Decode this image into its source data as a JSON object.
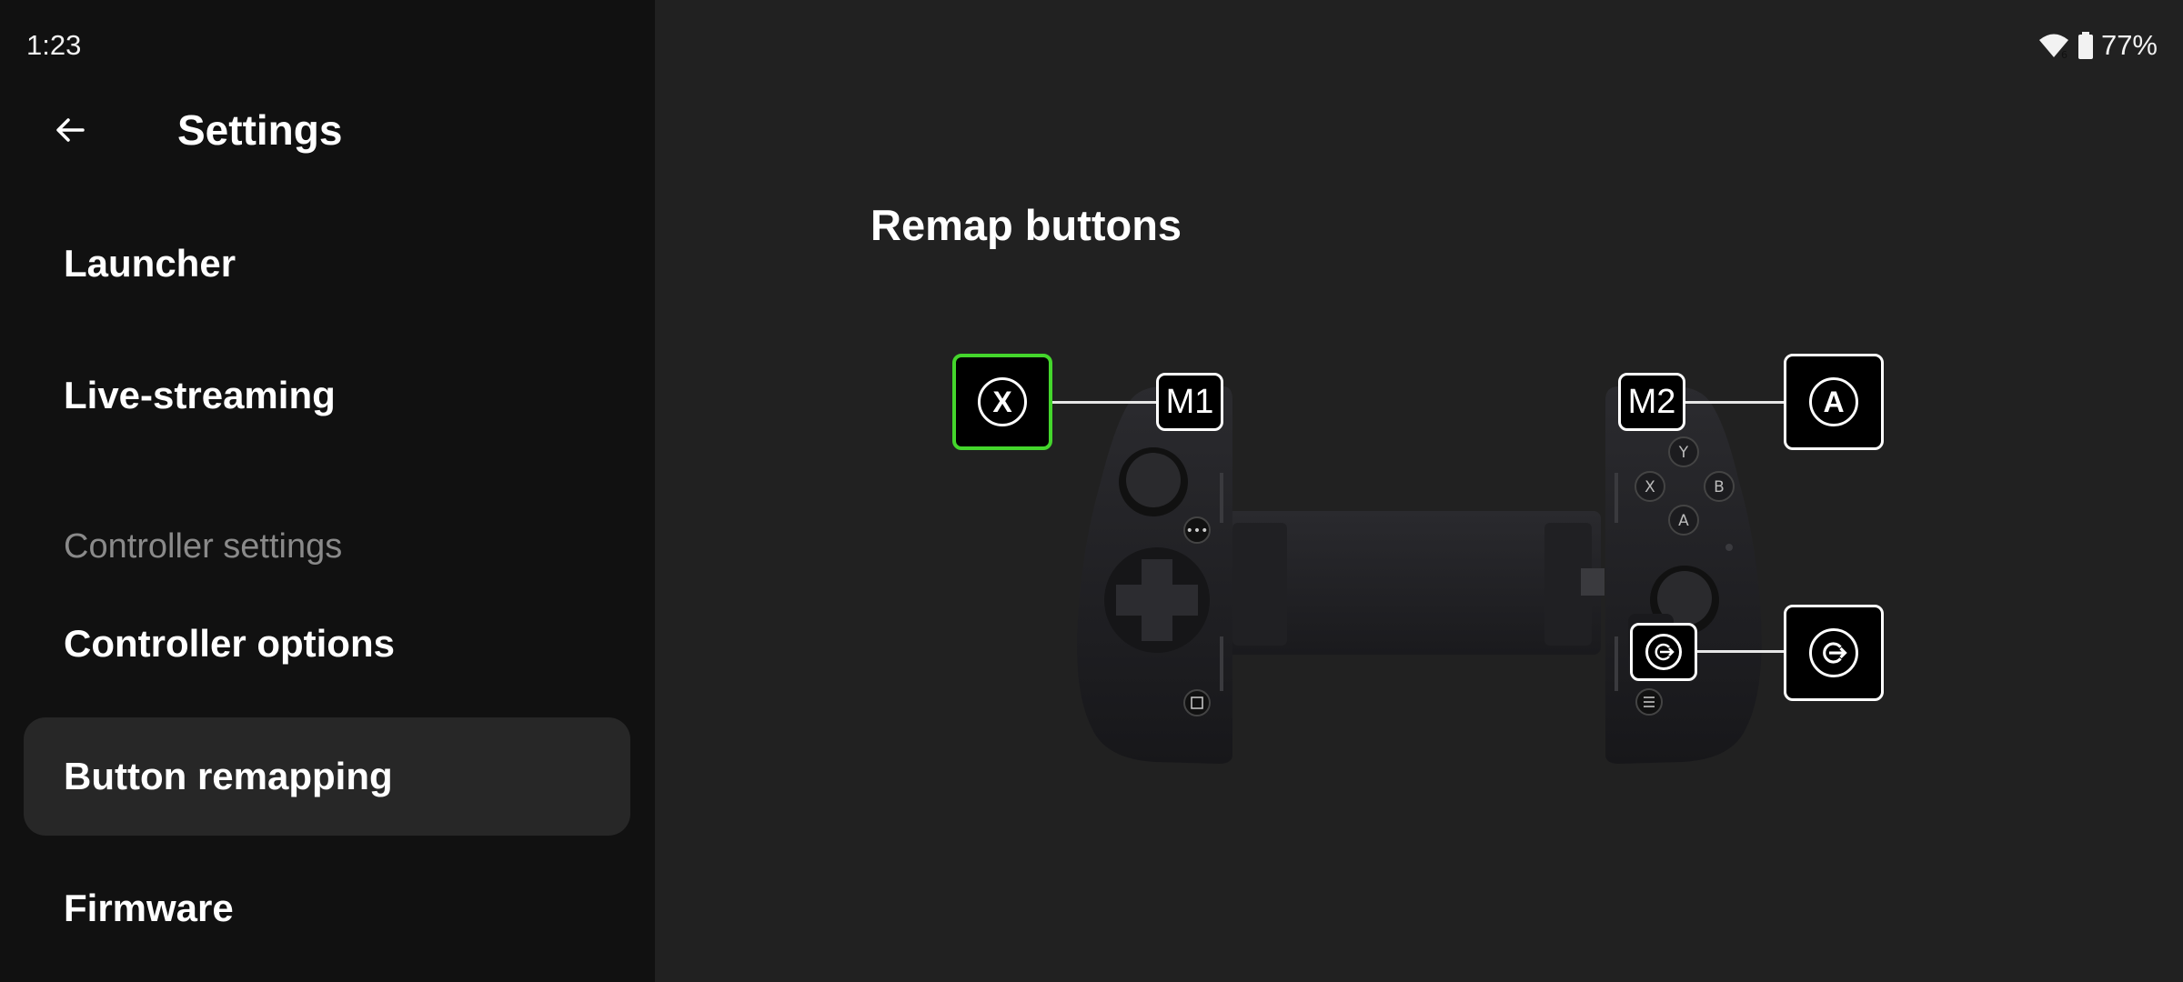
{
  "status_bar": {
    "time": "1:23",
    "battery": "77%",
    "wifi_icon": "wifi-icon",
    "battery_icon": "battery-icon"
  },
  "sidebar": {
    "title": "Settings",
    "items": [
      {
        "label": "Launcher"
      },
      {
        "label": "Live-streaming"
      },
      {
        "label": "Controller options"
      },
      {
        "label": "Button remapping"
      },
      {
        "label": "Firmware"
      }
    ],
    "section_label": "Controller settings",
    "active_item": "Button remapping"
  },
  "main": {
    "title": "Remap buttons",
    "mappings": {
      "m1": {
        "label": "M1",
        "mapped_to": "X"
      },
      "m2": {
        "label": "M2",
        "mapped_to": "A"
      },
      "share": {
        "mapped_to": "share-icon"
      }
    },
    "face_buttons": [
      "Y",
      "X",
      "B",
      "A"
    ]
  },
  "colors": {
    "accent": "#44d62c",
    "sidebar_bg": "#111111",
    "main_bg": "#212121",
    "active_item_bg": "#272727"
  }
}
